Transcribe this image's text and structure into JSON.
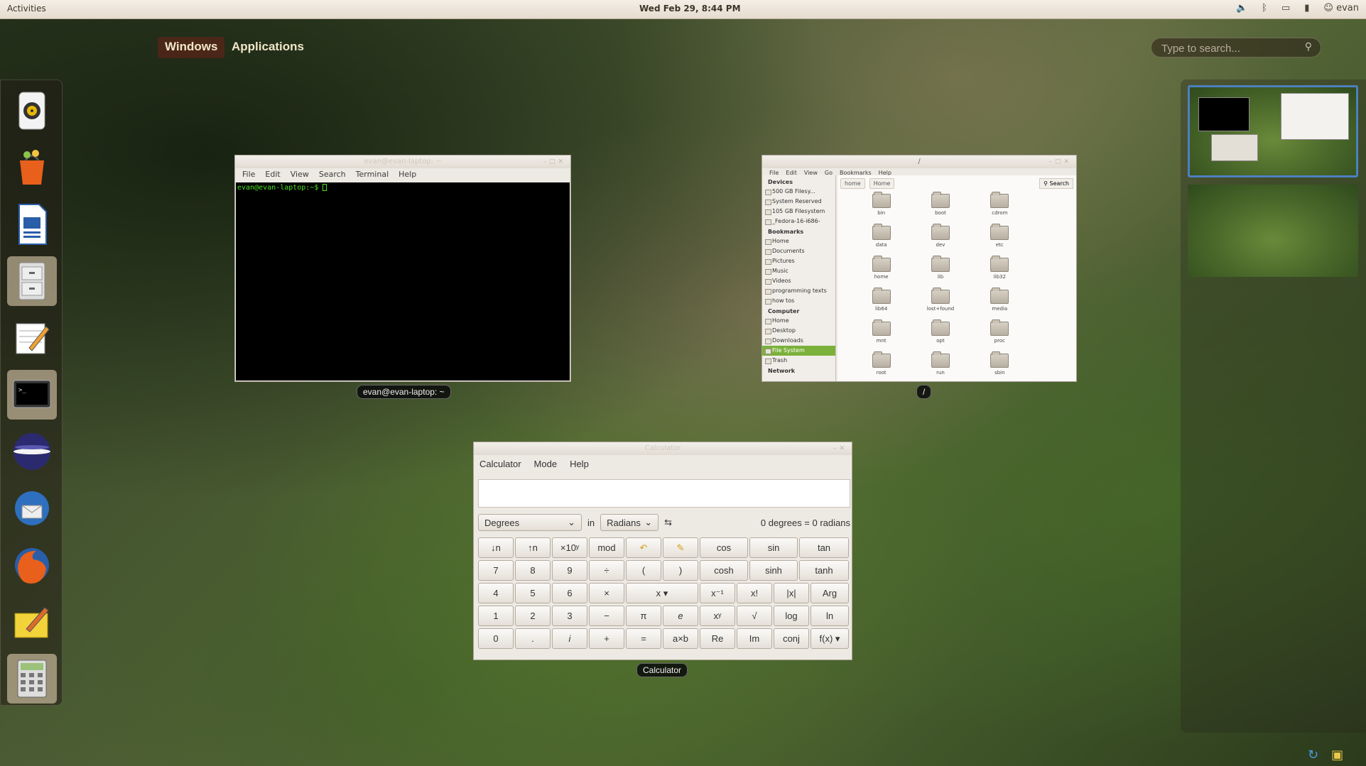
{
  "topbar": {
    "activities": "Activities",
    "clock": "Wed Feb 29,  8:44 PM",
    "user": "evan"
  },
  "overview": {
    "tab_windows": "Windows",
    "tab_applications": "Applications",
    "search_placeholder": "Type to search..."
  },
  "dock": {
    "items": [
      "rhythmbox-icon",
      "software-center-icon",
      "writer-icon",
      "file-manager-icon",
      "text-editor-icon",
      "terminal-icon",
      "eclipse-icon",
      "thunderbird-icon",
      "firefox-icon",
      "notes-icon",
      "calculator-icon"
    ]
  },
  "terminal": {
    "title": "evan@evan-laptop: ~",
    "menu": [
      "File",
      "Edit",
      "View",
      "Search",
      "Terminal",
      "Help"
    ],
    "prompt": "evan@evan-laptop:~$ ",
    "caption": "evan@evan-laptop: ~"
  },
  "files": {
    "title": "/",
    "menu": [
      "File",
      "Edit",
      "View",
      "Go",
      "Bookmarks",
      "Help"
    ],
    "path": [
      "home",
      "Home"
    ],
    "search": "Search",
    "sidebar": {
      "devices_header": "Devices",
      "devices": [
        "500 GB Filesy...",
        "System Reserved",
        "105 GB Filesystem",
        "_Fedora-16-i686-"
      ],
      "bookmarks_header": "Bookmarks",
      "bookmarks": [
        "Home",
        "Documents",
        "Pictures",
        "Music",
        "Videos",
        "programming texts",
        "how tos"
      ],
      "computer_header": "Computer",
      "computer": [
        "Home",
        "Desktop",
        "Downloads",
        "File System",
        "Trash"
      ],
      "network_header": "Network"
    },
    "folders": [
      "bin",
      "boot",
      "cdrom",
      "data",
      "dev",
      "etc",
      "home",
      "lib",
      "lib32",
      "lib64",
      "lost+found",
      "media",
      "mnt",
      "opt",
      "proc",
      "root",
      "run",
      "sbin"
    ],
    "caption": "/"
  },
  "calculator": {
    "title": "Calculator",
    "menu": [
      "Calculator",
      "Mode",
      "Help"
    ],
    "from_unit": "Degrees",
    "in_label": "in",
    "to_unit": "Radians",
    "swap": "⇆",
    "result": "0 degrees = 0 radians",
    "keys": [
      [
        "↓n",
        "↑n",
        "×10ʸ",
        "mod",
        "↶",
        "✎",
        "cos",
        "sin",
        "tan"
      ],
      [
        "7",
        "8",
        "9",
        "÷",
        "(",
        ")",
        "cosh",
        "sinh",
        "tanh"
      ],
      [
        "4",
        "5",
        "6",
        "×",
        "x ▾",
        "x⁻¹",
        "x!",
        "|x|",
        "Arg"
      ],
      [
        "1",
        "2",
        "3",
        "−",
        "π",
        "e",
        "xʸ",
        "√",
        "log",
        "ln"
      ],
      [
        "0",
        ".",
        "i",
        "+",
        "=",
        "a×b",
        "Re",
        "Im",
        "conj",
        "f(x) ▾"
      ]
    ],
    "caption": "Calculator"
  }
}
